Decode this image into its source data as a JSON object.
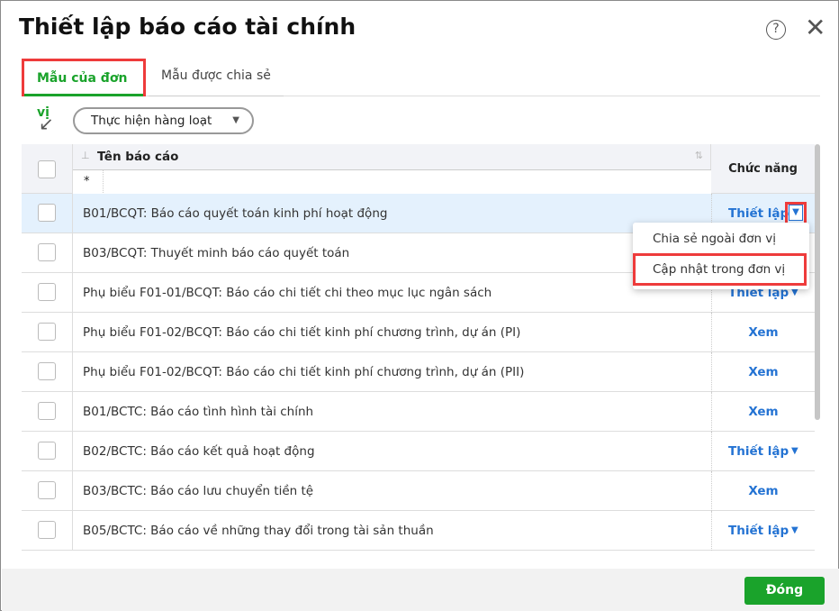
{
  "title": "Thiết lập báo cáo tài chính",
  "tabs": [
    {
      "label": "Mẫu của đơn vị",
      "active": true
    },
    {
      "label": "Mẫu được chia sẻ",
      "active": false
    }
  ],
  "toolbar": {
    "bulk_label": "Thực hiện hàng loạt"
  },
  "table": {
    "col_name": "Tên báo cáo",
    "col_function": "Chức năng",
    "filter_value": "*",
    "rows": [
      {
        "name": "B01/BCQT: Báo cáo quyết toán kinh phí hoạt động",
        "action": "Thiết lập",
        "has_dropdown": true,
        "selected": true
      },
      {
        "name": "B03/BCQT: Thuyết minh báo cáo quyết toán",
        "action": "",
        "has_dropdown": false
      },
      {
        "name": "Phụ biểu F01-01/BCQT: Báo cáo chi tiết chi theo mục lục ngân sách",
        "action": "Thiết lập",
        "has_dropdown": true
      },
      {
        "name": "Phụ biểu F01-02/BCQT: Báo cáo chi tiết kinh phí chương trình, dự án (PI)",
        "action": "Xem",
        "has_dropdown": false
      },
      {
        "name": "Phụ biểu F01-02/BCQT: Báo cáo chi tiết kinh phí chương trình, dự án (PII)",
        "action": "Xem",
        "has_dropdown": false
      },
      {
        "name": "B01/BCTC: Báo cáo tình hình tài chính",
        "action": "Xem",
        "has_dropdown": false
      },
      {
        "name": "B02/BCTC: Báo cáo kết quả hoạt động",
        "action": "Thiết lập",
        "has_dropdown": true
      },
      {
        "name": "B03/BCTC: Báo cáo lưu chuyển tiền tệ",
        "action": "Xem",
        "has_dropdown": false
      },
      {
        "name": "B05/BCTC: Báo cáo về những thay đổi trong tài sản thuần",
        "action": "Thiết lập",
        "has_dropdown": true
      }
    ]
  },
  "menu": {
    "items": [
      "Chia sẻ ngoài đơn vị",
      "Cập nhật trong đơn vị"
    ]
  },
  "footer": {
    "close_label": "Đóng"
  },
  "colors": {
    "accent": "#1aa32b",
    "link": "#2473d3",
    "highlight": "#ee3b3b"
  }
}
